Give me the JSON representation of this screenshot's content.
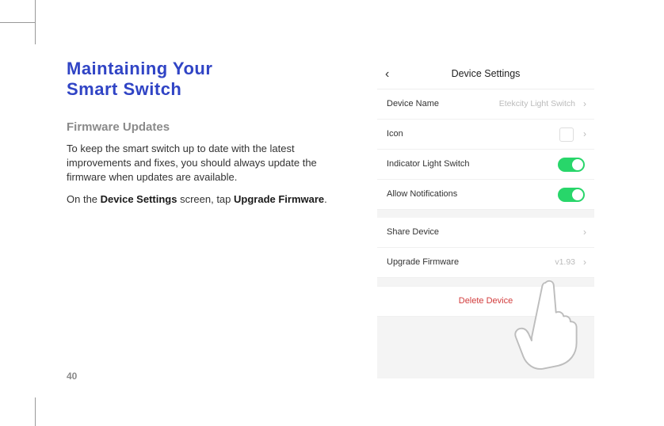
{
  "page_number": "40",
  "heading_line1": "Maintaining Your",
  "heading_line2": "Smart Switch",
  "section_heading": "Firmware Updates",
  "para1": "To keep the smart switch up to date with the latest improvements and fixes, you should always update the firmware when updates are available.",
  "para2_prefix": "On the ",
  "para2_b1": "Device Settings",
  "para2_mid": " screen, tap ",
  "para2_b2": "Upgrade Firmware",
  "para2_suffix": ".",
  "phone": {
    "title": "Device Settings",
    "rows": {
      "device_name_label": "Device Name",
      "device_name_value": "Etekcity Light Switch",
      "icon_label": "Icon",
      "indicator_label": "Indicator Light Switch",
      "notifications_label": "Allow Notifications",
      "share_label": "Share Device",
      "firmware_label": "Upgrade Firmware",
      "firmware_value": "v1.93",
      "delete_label": "Delete Device"
    }
  }
}
